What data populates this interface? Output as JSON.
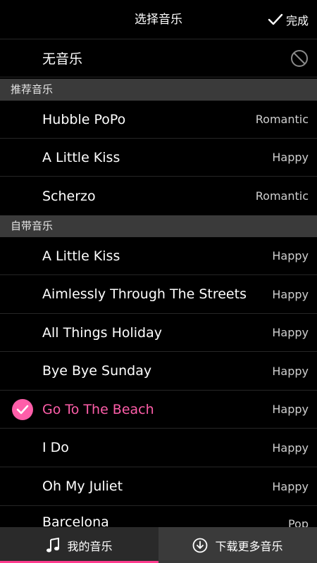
{
  "header": {
    "title": "选择音乐",
    "done_label": "完成"
  },
  "no_music": {
    "label": "无音乐"
  },
  "sections": {
    "recommended": "推荐音乐",
    "builtin": "自带音乐"
  },
  "recommended": [
    {
      "name": "Hubble PoPo",
      "tag": "Romantic"
    },
    {
      "name": "A Little Kiss",
      "tag": "Happy"
    },
    {
      "name": "Scherzo",
      "tag": "Romantic"
    }
  ],
  "builtin": [
    {
      "name": "A Little Kiss",
      "tag": "Happy"
    },
    {
      "name": "Aimlessly Through The Streets",
      "tag": "Happy"
    },
    {
      "name": "All Things Holiday",
      "tag": "Happy"
    },
    {
      "name": "Bye Bye Sunday",
      "tag": "Happy"
    },
    {
      "name": "Go To The Beach",
      "tag": "Happy",
      "selected": true
    },
    {
      "name": "I Do",
      "tag": "Happy"
    },
    {
      "name": "Oh My Juliet",
      "tag": "Happy"
    },
    {
      "name": "Barcelona",
      "tag": "Pop"
    }
  ],
  "bottom": {
    "my_music": "我的音乐",
    "download_more": "下载更多音乐"
  },
  "colors": {
    "accent": "#ff5ea9",
    "section_bg": "#3a3a3a",
    "bottom_indicator": "#ff3d8f"
  },
  "icons": {
    "done": "check-icon",
    "no_music": "prohibited-icon",
    "selected": "checkmark-circle-icon",
    "my_music": "music-note-icon",
    "download": "download-circle-icon"
  }
}
